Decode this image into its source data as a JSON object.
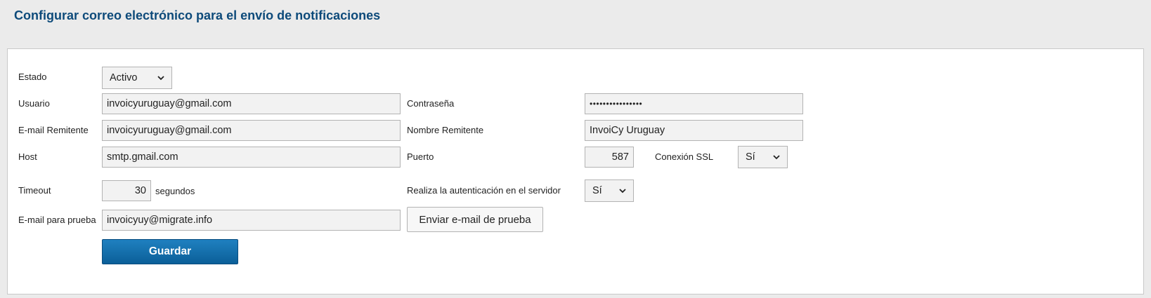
{
  "page": {
    "title": "Configurar correo electrónico para el envío de notificaciones"
  },
  "form": {
    "estado": {
      "label": "Estado",
      "value": "Activo"
    },
    "usuario": {
      "label": "Usuario",
      "value": "invoicyuruguay@gmail.com"
    },
    "contrasena": {
      "label": "Contraseña",
      "value": "••••••••••••••••"
    },
    "email_remitente": {
      "label": "E-mail Remitente",
      "value": "invoicyuruguay@gmail.com"
    },
    "nombre_remitente": {
      "label": "Nombre Remitente",
      "value": "InvoiCy Uruguay"
    },
    "host": {
      "label": "Host",
      "value": "smtp.gmail.com"
    },
    "puerto": {
      "label": "Puerto",
      "value": "587"
    },
    "conexion_ssl": {
      "label": "Conexión SSL",
      "value": "Sí"
    },
    "timeout": {
      "label": "Timeout",
      "value": "30",
      "unit": "segundos"
    },
    "autenticacion": {
      "label": "Realiza la autenticación en el servidor",
      "value": "Sí"
    },
    "email_prueba": {
      "label": "E-mail para prueba",
      "value": "invoicyuy@migrate.info"
    },
    "test_button": "Enviar e-mail de prueba",
    "save_button": "Guardar"
  },
  "icons": {
    "dropdown": "chevron-down-icon"
  },
  "colors": {
    "title": "#0d4a7a",
    "primary_button": "#0b5f98"
  }
}
